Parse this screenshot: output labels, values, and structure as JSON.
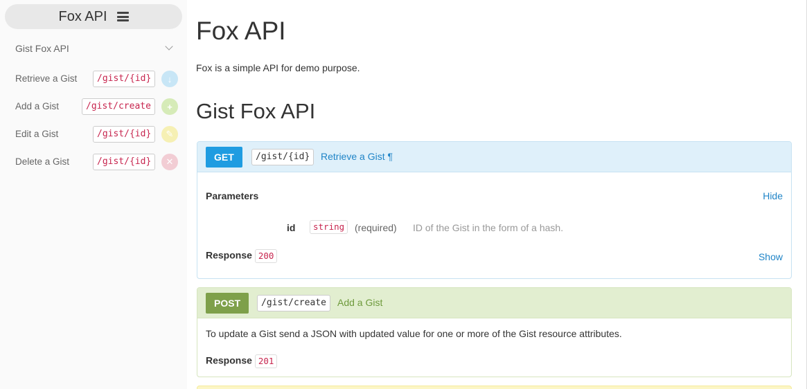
{
  "sidebar": {
    "brand": "Fox API",
    "group_title": "Gist Fox API",
    "items": [
      {
        "label": "Retrieve a Gist",
        "path": "/gist/{id}",
        "icon": "arrow-down-icon",
        "glyph": "↓",
        "color": "#c8e6f6"
      },
      {
        "label": "Add a Gist",
        "path": "/gist/create",
        "icon": "plus-icon",
        "glyph": "+",
        "color": "#d6ebb8"
      },
      {
        "label": "Edit a Gist",
        "path": "/gist/{id}",
        "icon": "pencil-icon",
        "glyph": "✎",
        "color": "#f6f0b4"
      },
      {
        "label": "Delete a Gist",
        "path": "/gist/{id}",
        "icon": "close-icon",
        "glyph": "✕",
        "color": "#f2cdd4"
      }
    ]
  },
  "main": {
    "title": "Fox API",
    "description": "Fox is a simple API for demo purpose.",
    "section_title": "Gist Fox API",
    "get_endpoint": {
      "method": "GET",
      "path": "/gist/{id}",
      "title": "Retrieve a Gist ¶",
      "parameters_label": "Parameters",
      "hide_label": "Hide",
      "param": {
        "name": "id",
        "type": "string",
        "required": "(required)",
        "description": "ID of the Gist in the form of a hash."
      },
      "response_label": "Response",
      "response_code": "200",
      "show_label": "Show"
    },
    "post_endpoint": {
      "method": "POST",
      "path": "/gist/create",
      "title": "Add a Gist",
      "description": "To update a Gist send a JSON with updated value for one or more of the Gist resource attributes.",
      "response_label": "Response",
      "response_code": "201"
    }
  }
}
